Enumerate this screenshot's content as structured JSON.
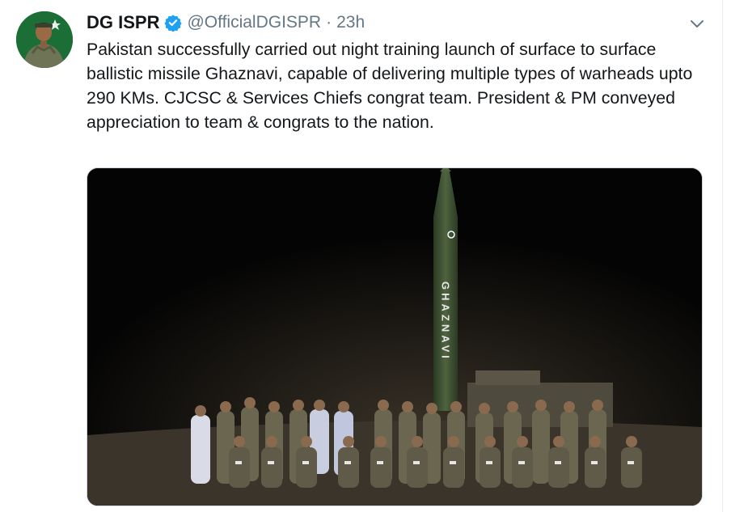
{
  "tweet": {
    "author_name": "DG ISPR",
    "handle": "@OfficialDGISPR",
    "separator": "·",
    "time": "23h",
    "text": "Pakistan successfully carried out night training launch of surface to surface ballistic missile Ghaznavi, capable of delivering multiple types of warheads upto 290 KMs. CJCSC & Services Chiefs congrat team. President & PM conveyed appreciation to team & congrats to the nation.",
    "media": {
      "missile_marking": "GHAZNAVI"
    }
  },
  "icons": {
    "verified": "verified-badge-icon",
    "menu": "chevron-down-icon"
  },
  "colors": {
    "text": "#14171a",
    "secondary": "#657786",
    "verified": "#1da1f2",
    "border": "#ccd6dd"
  }
}
